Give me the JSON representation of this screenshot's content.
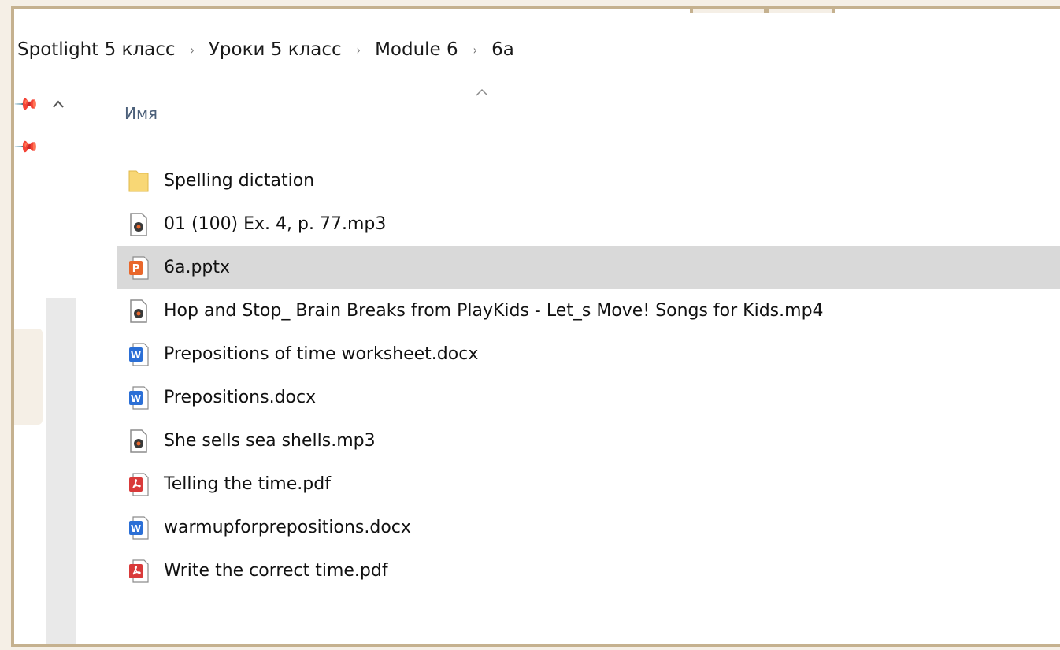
{
  "breadcrumb": [
    "Spotlight 5 класс",
    "Уроки 5 класс",
    "Module 6",
    "6a"
  ],
  "breadcrumb_separator": "›",
  "column_header": "Имя",
  "selected_index": 2,
  "files": [
    {
      "name": "Spelling dictation",
      "type": "folder"
    },
    {
      "name": "01 (100) Ex. 4, p. 77.mp3",
      "type": "media"
    },
    {
      "name": "6a.pptx",
      "type": "powerpoint"
    },
    {
      "name": "Hop and Stop_ Brain Breaks from PlayKids - Let_s Move! Songs for Kids.mp4",
      "type": "media"
    },
    {
      "name": "Prepositions of time worksheet.docx",
      "type": "word"
    },
    {
      "name": "Prepositions.docx",
      "type": "word"
    },
    {
      "name": "She sells sea shells.mp3",
      "type": "media"
    },
    {
      "name": "Telling the time.pdf",
      "type": "pdf"
    },
    {
      "name": "warmupforprepositions.docx",
      "type": "word"
    },
    {
      "name": "Write the correct time.pdf",
      "type": "pdf"
    }
  ],
  "icons": {
    "pin": "pin-icon",
    "collapse": "chevron-up-icon",
    "sort": "sort-ascending-icon",
    "folder": "folder-icon",
    "media": "media-file-icon",
    "powerpoint": "powerpoint-file-icon",
    "word": "word-file-icon",
    "pdf": "pdf-file-icon"
  },
  "colors": {
    "frame_border": "#c5b18f",
    "background": "#f5efe6",
    "selection": "#d9d9d9",
    "folder": "#f8d775",
    "powerpoint": "#e9672b",
    "word": "#2b6fd6",
    "pdf": "#d93a3a",
    "header_text": "#4c607a"
  }
}
